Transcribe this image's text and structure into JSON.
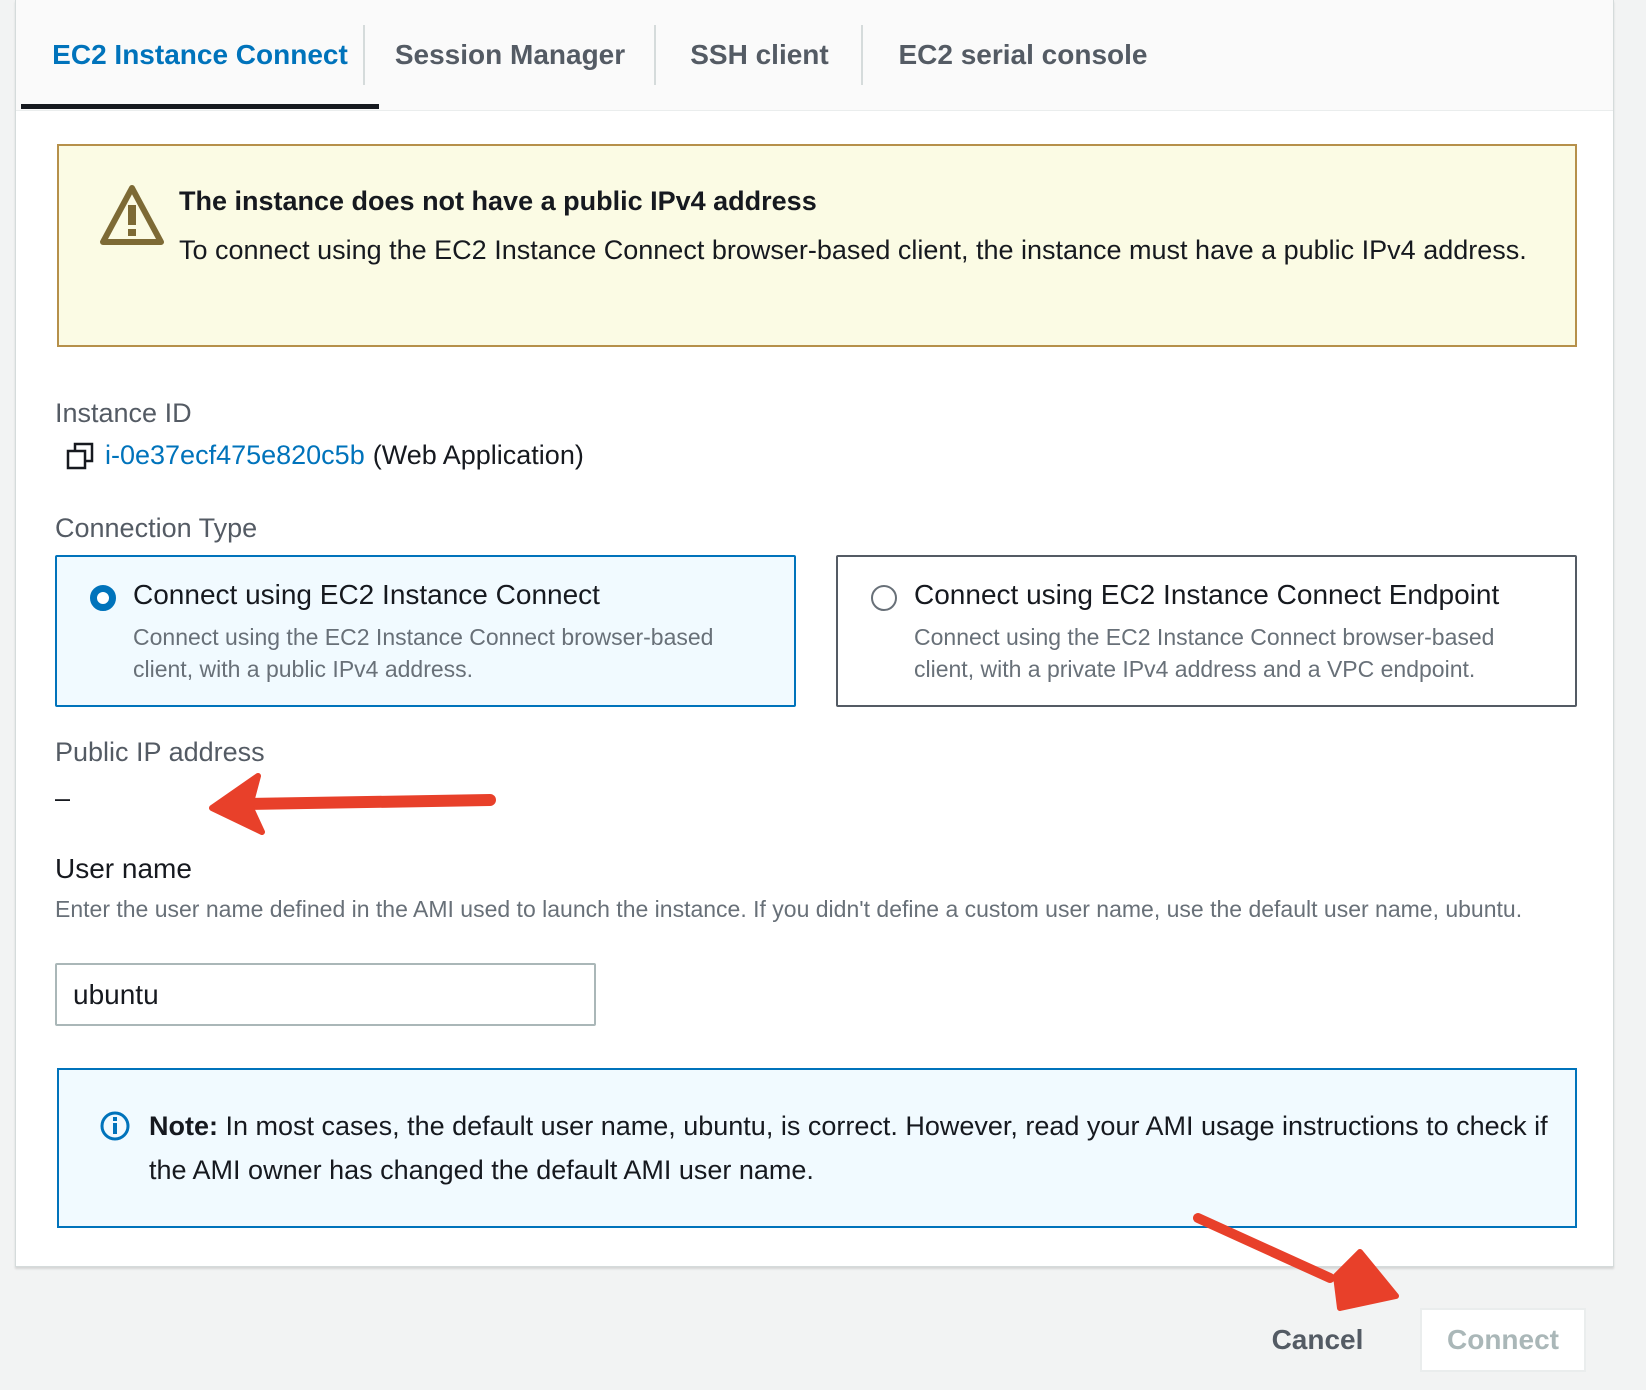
{
  "tabs": [
    {
      "label": "EC2 Instance Connect",
      "active": true
    },
    {
      "label": "Session Manager",
      "active": false
    },
    {
      "label": "SSH client",
      "active": false
    },
    {
      "label": "EC2 serial console",
      "active": false
    }
  ],
  "warning": {
    "icon": "warning-icon",
    "title": "The instance does not have a public IPv4 address",
    "text": "To connect using the EC2 Instance Connect browser-based client, the instance must have a public IPv4 address."
  },
  "instance": {
    "label": "Instance ID",
    "id": "i-0e37ecf475e820c5b",
    "name": "(Web Application)",
    "icon": "copy-icon"
  },
  "connection_type": {
    "label": "Connection Type",
    "options": [
      {
        "title": "Connect using EC2 Instance Connect",
        "description": "Connect using the EC2 Instance Connect browser-based client, with a public IPv4 address.",
        "selected": true
      },
      {
        "title": "Connect using EC2 Instance Connect Endpoint",
        "description": "Connect using the EC2 Instance Connect browser-based client, with a private IPv4 address and a VPC endpoint.",
        "selected": false
      }
    ]
  },
  "public_ip": {
    "label": "Public IP address",
    "value": "–"
  },
  "username": {
    "label": "User name",
    "description": "Enter the user name defined in the AMI used to launch the instance. If you didn't define a custom user name, use the default user name, ubuntu.",
    "value": "ubuntu"
  },
  "note": {
    "icon": "info-icon",
    "bold": "Note:",
    "text": " In most cases, the default user name, ubuntu, is correct. However, read your AMI usage instructions to check if the AMI owner has changed the default AMI user name."
  },
  "actions": {
    "cancel": "Cancel",
    "connect": "Connect"
  },
  "colors": {
    "accent": "#0073bb",
    "warning_border": "#b6904a",
    "annotation": "#e8402a"
  }
}
